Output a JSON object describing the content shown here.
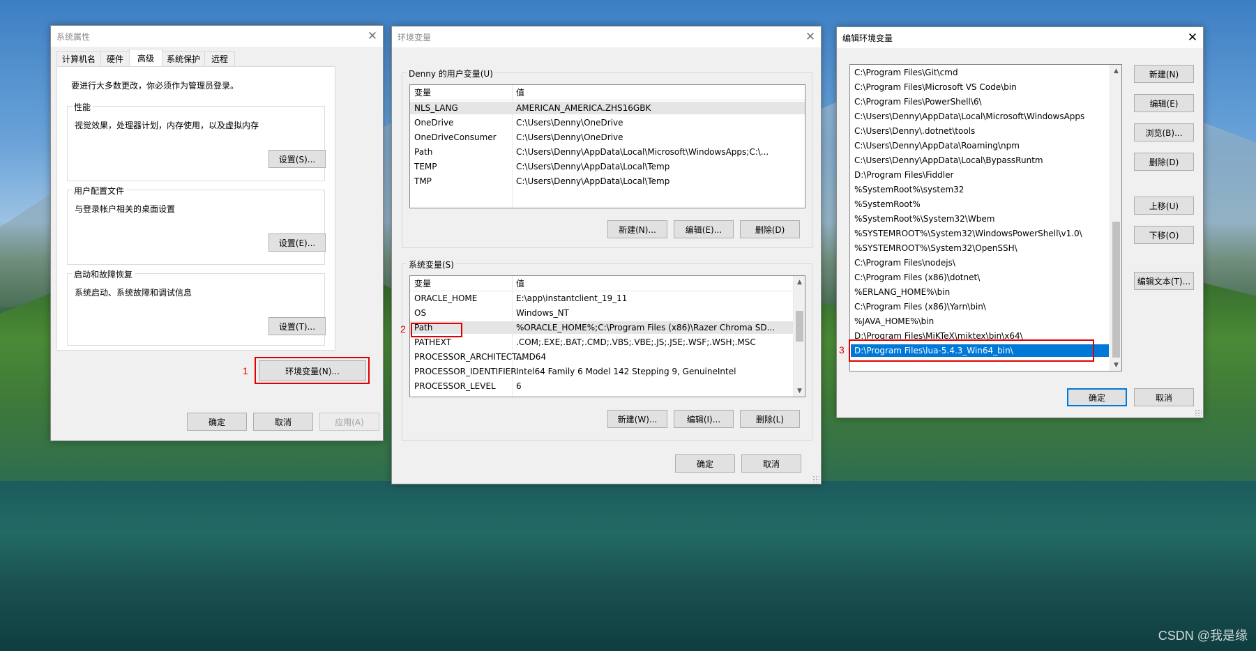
{
  "watermark": "CSDN @我是缘",
  "sysprops": {
    "title": "系统属性",
    "tabs": [
      "计算机名",
      "硬件",
      "高级",
      "系统保护",
      "远程"
    ],
    "active_tab": "高级",
    "admin_note": "要进行大多数更改，你必须作为管理员登录。",
    "performance": {
      "label": "性能",
      "desc": "视觉效果，处理器计划，内存使用，以及虚拟内存",
      "button": "设置(S)..."
    },
    "profiles": {
      "label": "用户配置文件",
      "desc": "与登录帐户相关的桌面设置",
      "button": "设置(E)..."
    },
    "startup": {
      "label": "启动和故障恢复",
      "desc": "系统启动、系统故障和调试信息",
      "button": "设置(T)..."
    },
    "env_button": "环境变量(N)...",
    "ok": "确定",
    "cancel": "取消",
    "apply": "应用(A)"
  },
  "envvars": {
    "title": "环境变量",
    "user_group": "Denny 的用户变量(U)",
    "col_var": "变量",
    "col_val": "值",
    "user_vars": [
      {
        "name": "NLS_LANG",
        "value": "AMERICAN_AMERICA.ZHS16GBK"
      },
      {
        "name": "OneDrive",
        "value": "C:\\Users\\Denny\\OneDrive"
      },
      {
        "name": "OneDriveConsumer",
        "value": "C:\\Users\\Denny\\OneDrive"
      },
      {
        "name": "Path",
        "value": "C:\\Users\\Denny\\AppData\\Local\\Microsoft\\WindowsApps;C:\\..."
      },
      {
        "name": "TEMP",
        "value": "C:\\Users\\Denny\\AppData\\Local\\Temp"
      },
      {
        "name": "TMP",
        "value": "C:\\Users\\Denny\\AppData\\Local\\Temp"
      }
    ],
    "user_buttons": {
      "new": "新建(N)...",
      "edit": "编辑(E)...",
      "delete": "删除(D)"
    },
    "sys_group": "系统变量(S)",
    "sys_vars": [
      {
        "name": "ORACLE_HOME",
        "value": "E:\\app\\instantclient_19_11"
      },
      {
        "name": "OS",
        "value": "Windows_NT"
      },
      {
        "name": "Path",
        "value": "%ORACLE_HOME%;C:\\Program Files (x86)\\Razer Chroma SD..."
      },
      {
        "name": "PATHEXT",
        "value": ".COM;.EXE;.BAT;.CMD;.VBS;.VBE;.JS;.JSE;.WSF;.WSH;.MSC"
      },
      {
        "name": "PROCESSOR_ARCHITECT...",
        "value": "AMD64"
      },
      {
        "name": "PROCESSOR_IDENTIFIER",
        "value": "Intel64 Family 6 Model 142 Stepping 9, GenuineIntel"
      },
      {
        "name": "PROCESSOR_LEVEL",
        "value": "6"
      }
    ],
    "sys_buttons": {
      "new": "新建(W)...",
      "edit": "编辑(I)...",
      "delete": "删除(L)"
    },
    "ok": "确定",
    "cancel": "取消"
  },
  "editenv": {
    "title": "编辑环境变量",
    "entries": [
      "C:\\Program Files\\Git\\cmd",
      "C:\\Program Files\\Microsoft VS Code\\bin",
      "C:\\Program Files\\PowerShell\\6\\",
      "C:\\Users\\Denny\\AppData\\Local\\Microsoft\\WindowsApps",
      "C:\\Users\\Denny\\.dotnet\\tools",
      "C:\\Users\\Denny\\AppData\\Roaming\\npm",
      "C:\\Users\\Denny\\AppData\\Local\\BypassRuntm",
      "D:\\Program Files\\Fiddler",
      "%SystemRoot%\\system32",
      "%SystemRoot%",
      "%SystemRoot%\\System32\\Wbem",
      "%SYSTEMROOT%\\System32\\WindowsPowerShell\\v1.0\\",
      "%SYSTEMROOT%\\System32\\OpenSSH\\",
      "C:\\Program Files\\nodejs\\",
      "C:\\Program Files (x86)\\dotnet\\",
      "%ERLANG_HOME%\\bin",
      "C:\\Program Files (x86)\\Yarn\\bin\\",
      "%JAVA_HOME%\\bin",
      "D:\\Program Files\\MiKTeX\\miktex\\bin\\x64\\",
      "D:\\Program Files\\lua-5.4.3_Win64_bin\\"
    ],
    "buttons": {
      "new": "新建(N)",
      "edit": "编辑(E)",
      "browse": "浏览(B)...",
      "delete": "删除(D)",
      "up": "上移(U)",
      "down": "下移(O)",
      "edit_text": "编辑文本(T)..."
    },
    "ok": "确定",
    "cancel": "取消"
  },
  "annotations": {
    "step1": "1",
    "step2": "2",
    "step3": "3"
  }
}
